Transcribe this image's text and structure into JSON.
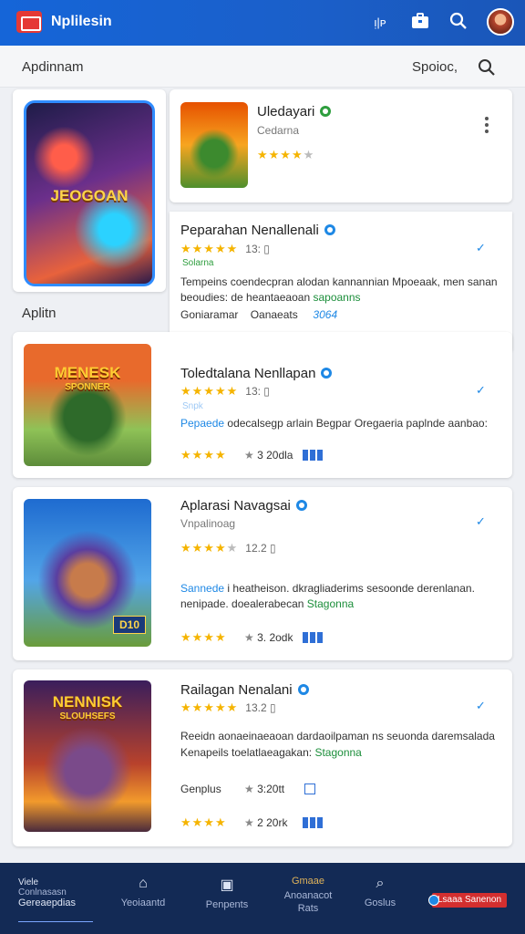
{
  "app": {
    "title": "Nplilesin"
  },
  "topbar": {
    "icons": [
      "grid-icon",
      "briefcase-icon",
      "search-icon",
      "avatar"
    ],
    "icon_glyph_1": "ᴉ|ᴘ"
  },
  "section": {
    "label": "Apdinnam",
    "sort_label": "Spoioc,"
  },
  "side_label": "Aplitn",
  "featured": {
    "art_text": "JEOGOAN"
  },
  "apps": [
    {
      "title": "Uledayari",
      "sub": "Cedarna",
      "rating": 4,
      "verified": "green"
    },
    {
      "title": "Peparahan Nenallenali",
      "rating": 5,
      "meta": "13: ▯",
      "tag": "Solarna",
      "desc1": "Tempeins coendecpran alodan kannannian Mpoeaak, men sanan",
      "desc2": "beoudies: de heantaeaoan",
      "desc2_hl": "sapoanns",
      "info1": "Goniaramar",
      "info2": "Oanaeats",
      "info3": "3064"
    },
    {
      "title": "Toledtalana Nenllapan",
      "rating": 5,
      "meta": "13: ▯",
      "tag": "Snpk",
      "art_text": "MENESK",
      "art_sub": "SPONNER",
      "desc_hl": "Pepaede",
      "desc": "odecalsegp arlain Begpar Oregaeria paplnde aanbao:",
      "foot_count": "3 20dla"
    },
    {
      "title": "Aplarasi Navagsai",
      "sub": "Vnpalinoag",
      "rating": 4,
      "meta": "12.2 ▯",
      "art_badge": "D10",
      "desc_hl": "Sannede",
      "desc1": "i heatheison. dkragliaderims sesoonde derenlanan.",
      "desc2": "nenipade. doealerabecan",
      "desc2_hl": "Stagonna",
      "foot_count": "3. 2odk"
    },
    {
      "title": "Railagan Nenalani",
      "rating": 5,
      "meta": "13.2 ▯",
      "art_text": "NENNISK",
      "art_sub": "SLOUHSEFS",
      "desc1": "Reeidn aonaeinaeaoan dardaoilpaman ns seuonda daremsalada",
      "desc2": "Kenapeils toelatlaeagakan:",
      "desc2_hl": "Stagonna",
      "info1": "Genplus",
      "info2": "3:20tt",
      "foot_count": "2 20rk"
    }
  ],
  "bottom_nav": {
    "home": {
      "l1": "Viele",
      "l2": "Conlnasasn",
      "l3": "Gereaepdias"
    },
    "items": [
      {
        "icon": "store-icon",
        "label": "Yeoiaantd"
      },
      {
        "icon": "image-icon",
        "label": "Penpents"
      },
      {
        "icon": "",
        "label": "Gmaae",
        "label2": "Anoanacot",
        "label3": "Rats"
      },
      {
        "icon": "search-icon",
        "label": "Goslus"
      }
    ],
    "cta": "Lsaaa Sanenon"
  },
  "colors": {
    "primary": "#1565d8",
    "star": "#f5b400",
    "nav_bg": "#132a55",
    "accent_red": "#d32f2f",
    "green": "#2e9e3e"
  }
}
